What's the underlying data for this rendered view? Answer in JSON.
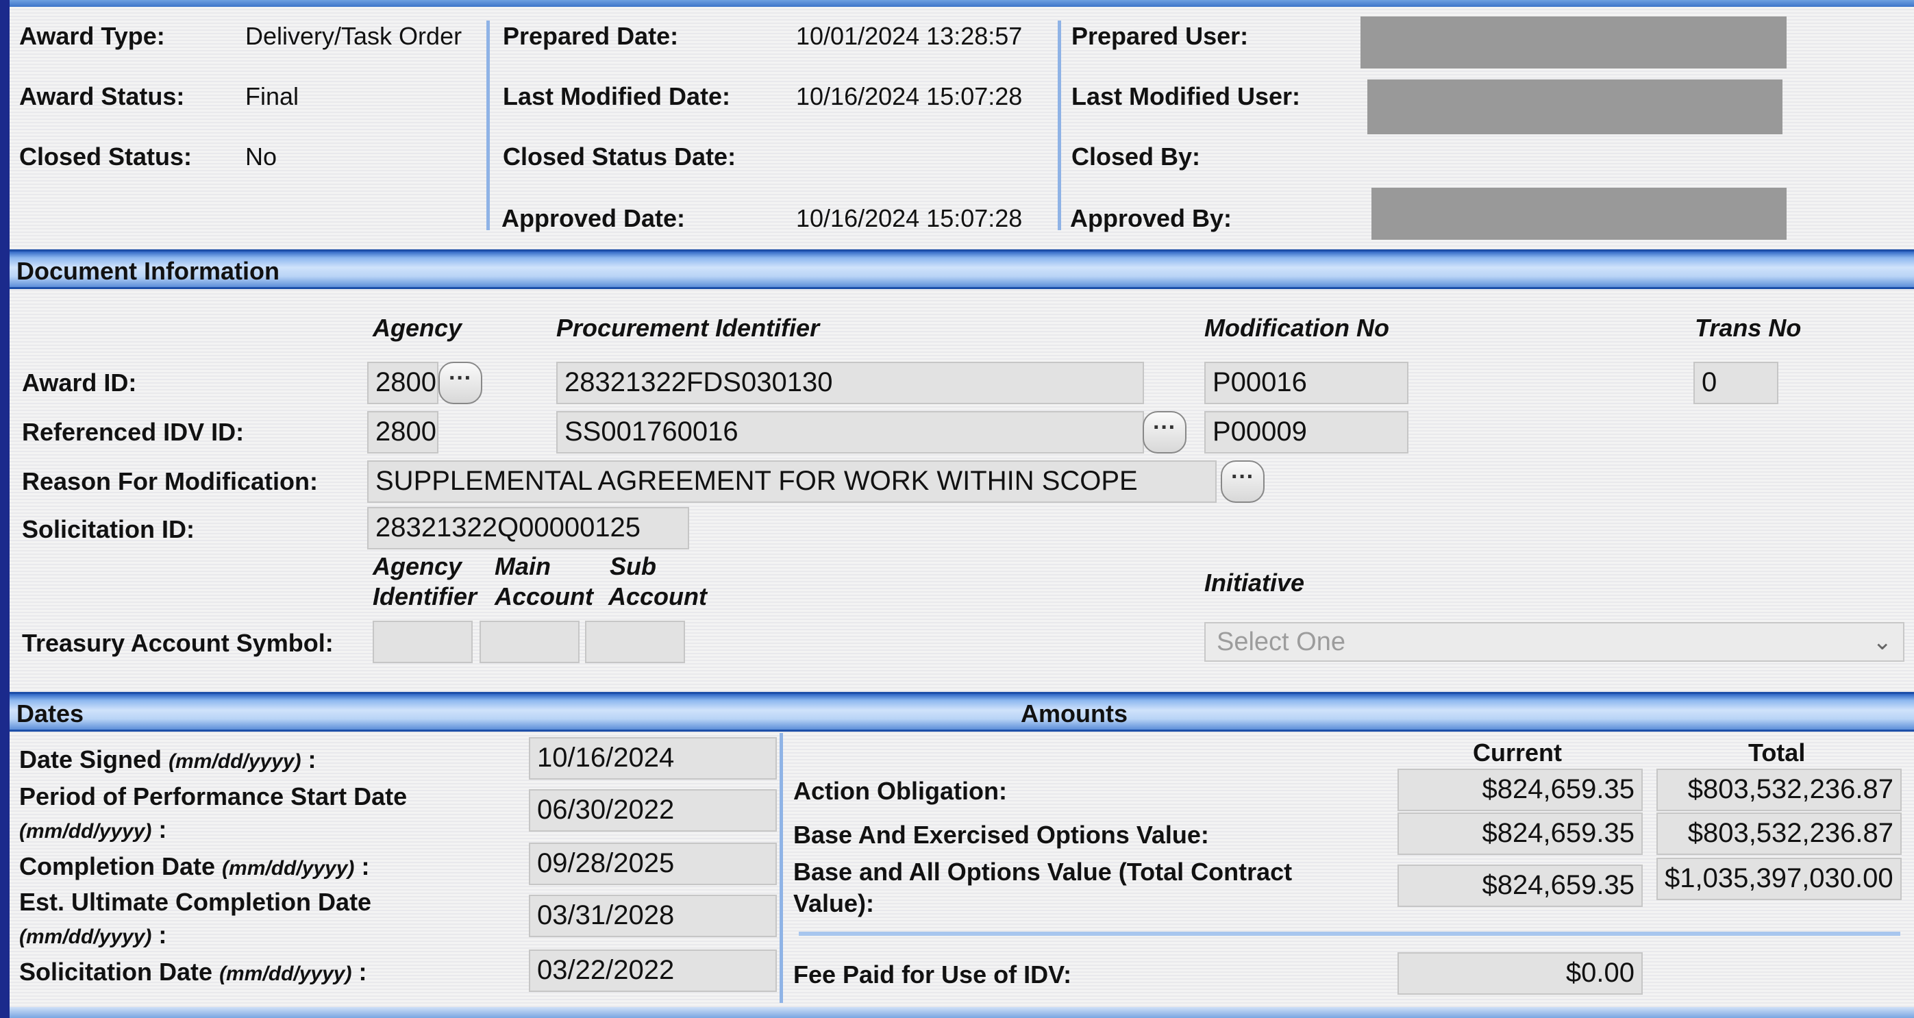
{
  "header": {
    "award_type_label": "Award Type:",
    "award_type_value": "Delivery/Task Order",
    "award_status_label": "Award Status:",
    "award_status_value": "Final",
    "closed_status_label": "Closed Status:",
    "closed_status_value": "No",
    "prepared_date_label": "Prepared Date:",
    "prepared_date_value": "10/01/2024 13:28:57",
    "last_modified_date_label": "Last Modified Date:",
    "last_modified_date_value": "10/16/2024 15:07:28",
    "closed_status_date_label": "Closed Status Date:",
    "approved_date_label": "Approved Date:",
    "approved_date_value": "10/16/2024 15:07:28",
    "prepared_user_label": "Prepared User:",
    "last_modified_user_label": "Last Modified User:",
    "closed_by_label": "Closed By:",
    "approved_by_label": "Approved By:"
  },
  "document_info": {
    "title": "Document Information",
    "col_agency": "Agency",
    "col_procurement": "Procurement Identifier",
    "col_modification": "Modification No",
    "col_trans": "Trans No",
    "award_id_label": "Award ID:",
    "award_id_agency": "2800",
    "award_id_procurement": "28321322FDS030130",
    "award_id_modification": "P00016",
    "award_id_trans": "0",
    "ref_idv_label": "Referenced IDV ID:",
    "ref_idv_agency": "2800",
    "ref_idv_procurement": "SS001760016",
    "ref_idv_modification": "P00009",
    "reason_label": "Reason For Modification:",
    "reason_value": "SUPPLEMENTAL AGREEMENT FOR WORK WITHIN SCOPE",
    "solicitation_label": "Solicitation ID:",
    "solicitation_value": "28321322Q00000125",
    "tas_head_agency_1": "Agency",
    "tas_head_agency_2": "Identifier",
    "tas_head_main_1": "Main",
    "tas_head_main_2": "Account",
    "tas_head_sub_1": "Sub",
    "tas_head_sub_2": "Account",
    "tas_label": "Treasury Account Symbol:",
    "initiative_label": "Initiative",
    "initiative_placeholder": "Select One",
    "ellipsis": "···"
  },
  "dates": {
    "title": "Dates",
    "format_hint": "(mm/dd/yyyy)",
    "date_signed_label": "Date Signed",
    "date_signed_value": "10/16/2024",
    "pop_start_label": "Period of Performance Start Date",
    "pop_start_value": "06/30/2022",
    "completion_label": "Completion Date",
    "completion_value": "09/28/2025",
    "est_ult_label": "Est. Ultimate Completion Date",
    "est_ult_value": "03/31/2028",
    "solicitation_date_label": "Solicitation Date",
    "solicitation_date_value": "03/22/2022",
    "colon": ":"
  },
  "amounts": {
    "title": "Amounts",
    "col_current": "Current",
    "col_total": "Total",
    "action_obligation_label": "Action Obligation:",
    "action_obligation_current": "$824,659.35",
    "action_obligation_total": "$803,532,236.87",
    "base_exercised_label": "Base And Exercised Options Value:",
    "base_exercised_current": "$824,659.35",
    "base_exercised_total": "$803,532,236.87",
    "base_all_label_1": "Base and All Options Value (Total Contract",
    "base_all_label_2": "Value):",
    "base_all_current": "$824,659.35",
    "base_all_total": "$1,035,397,030.00",
    "fee_label": "Fee Paid for Use of IDV:",
    "fee_current": "$0.00"
  }
}
